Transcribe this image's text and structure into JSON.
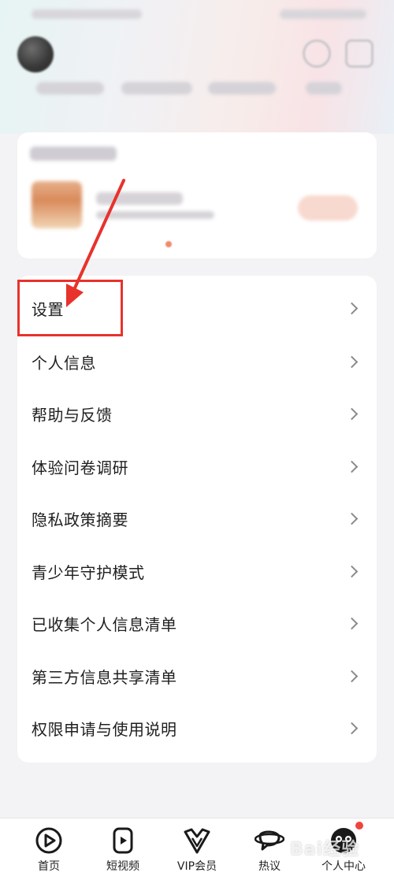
{
  "menu": {
    "items": [
      {
        "label": "设置"
      },
      {
        "label": "个人信息"
      },
      {
        "label": "帮助与反馈"
      },
      {
        "label": "体验问卷调研"
      },
      {
        "label": "隐私政策摘要"
      },
      {
        "label": "青少年守护模式"
      },
      {
        "label": "已收集个人信息清单"
      },
      {
        "label": "第三方信息共享清单"
      },
      {
        "label": "权限申请与使用说明"
      }
    ]
  },
  "bottom_nav": {
    "items": [
      {
        "label": "首页",
        "icon": "play-circle-icon"
      },
      {
        "label": "短视频",
        "icon": "short-video-icon"
      },
      {
        "label": "VIP会员",
        "icon": "vip-crown-icon"
      },
      {
        "label": "热议",
        "icon": "planet-chat-icon"
      },
      {
        "label": "个人中心",
        "icon": "user-avatar-icon"
      }
    ]
  },
  "watermark": "Bai经验",
  "colors": {
    "annotation_red": "#e8322c",
    "page_background": "#f3f3f5",
    "card_background": "#ffffff",
    "notification_dot": "#f0443b"
  }
}
